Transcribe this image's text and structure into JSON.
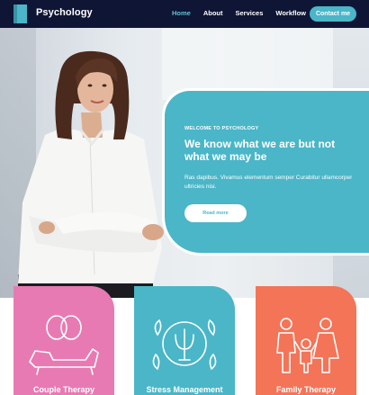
{
  "brand": {
    "name": "Psychology",
    "logo_icon": "book-icon",
    "accent": "#4ab6c8",
    "nav_bg": "#0f1535"
  },
  "nav": {
    "links": [
      {
        "label": "Home",
        "active": true
      },
      {
        "label": "About",
        "active": false
      },
      {
        "label": "Services",
        "active": false
      },
      {
        "label": "Workflow",
        "active": false
      }
    ],
    "cta": "Contact me"
  },
  "hero": {
    "eyebrow": "WELCOME TO PSYCHOLOGY",
    "title": "We know what we are but not what we may be",
    "body": "Ras dapibus. Vivamus elementum semper Curabitur ullamcorper ultricies nisi.",
    "button": "Read more"
  },
  "services": [
    {
      "label": "Couple Therapy",
      "icon": "couple-therapy-icon",
      "color": "#e87ab3"
    },
    {
      "label": "Stress Management",
      "icon": "psi-icon",
      "color": "#4ab6c8"
    },
    {
      "label": "Family Therapy",
      "icon": "family-icon",
      "color": "#f47458"
    }
  ]
}
